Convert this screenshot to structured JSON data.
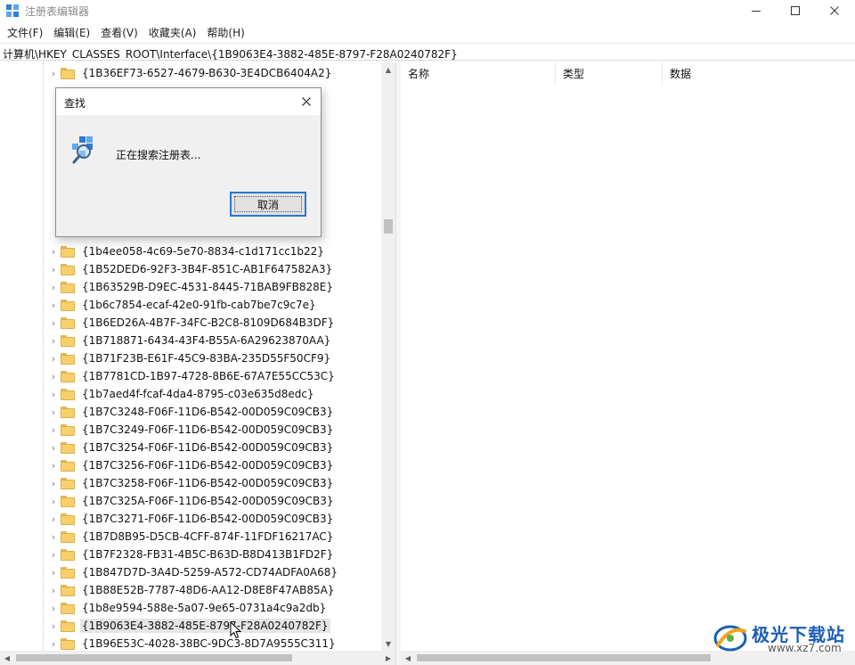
{
  "window": {
    "title": "注册表编辑器",
    "controls": {
      "minimize": "minimize-icon",
      "maximize": "maximize-icon",
      "close": "close-icon"
    }
  },
  "menu": [
    "文件(F)",
    "编辑(E)",
    "查看(V)",
    "收藏夹(A)",
    "帮助(H)"
  ],
  "address": "计算机\\HKEY_CLASSES_ROOT\\Interface\\{1B9063E4-3882-485E-8797-F28A0240782F}",
  "tree": {
    "items": [
      {
        "label": "{1B36EF73-6527-4679-B630-3E4DCB6404A2}"
      },
      {
        "label": "{1b4ee058-4c69-5e70-8834-c1d171cc1b22}"
      },
      {
        "label": "{1B52DED6-92F3-3B4F-851C-AB1F647582A3}"
      },
      {
        "label": "{1B63529B-D9EC-4531-8445-71BAB9FB828E}"
      },
      {
        "label": "{1b6c7854-ecaf-42e0-91fb-cab7be7c9c7e}"
      },
      {
        "label": "{1B6ED26A-4B7F-34FC-B2C8-8109D684B3DF}"
      },
      {
        "label": "{1B718871-6434-43F4-B55A-6A29623870AA}"
      },
      {
        "label": "{1B71F23B-E61F-45C9-83BA-235D55F50CF9}"
      },
      {
        "label": "{1B7781CD-1B97-4728-8B6E-67A7E55CC53C}"
      },
      {
        "label": "{1b7aed4f-fcaf-4da4-8795-c03e635d8edc}"
      },
      {
        "label": "{1B7C3248-F06F-11D6-B542-00D059C09CB3}"
      },
      {
        "label": "{1B7C3249-F06F-11D6-B542-00D059C09CB3}"
      },
      {
        "label": "{1B7C3254-F06F-11D6-B542-00D059C09CB3}"
      },
      {
        "label": "{1B7C3256-F06F-11D6-B542-00D059C09CB3}"
      },
      {
        "label": "{1B7C3258-F06F-11D6-B542-00D059C09CB3}"
      },
      {
        "label": "{1B7C325A-F06F-11D6-B542-00D059C09CB3}"
      },
      {
        "label": "{1B7C3271-F06F-11D6-B542-00D059C09CB3}"
      },
      {
        "label": "{1B7D8B95-D5CB-4CFF-874F-11FDF16217AC}"
      },
      {
        "label": "{1B7F2328-FB31-4B5C-B63D-B8D413B1FD2F}"
      },
      {
        "label": "{1B847D7D-3A4D-5259-A572-CD74ADFA0A68}"
      },
      {
        "label": "{1B88E52B-7787-48D6-AA12-D8E8F47AB85A}"
      },
      {
        "label": "{1b8e9594-588e-5a07-9e65-0731a4c9a2db}"
      },
      {
        "label": "{1B9063E4-3882-485E-8797-F28A0240782F}",
        "selected": true
      },
      {
        "label": "{1B96E53C-4028-38BC-9DC3-8D7A9555C311}"
      }
    ]
  },
  "values_pane": {
    "columns": [
      "名称",
      "类型",
      "数据"
    ]
  },
  "find_dialog": {
    "title": "查找",
    "message": "正在搜索注册表...",
    "cancel_label": "取消",
    "icon": "registry-search-icon"
  },
  "watermark": {
    "text": "极光下载站",
    "url": "www.xz7.com"
  },
  "colors": {
    "folder": "#f7cf6b",
    "selection": "#e5e5e5",
    "dialog_background": "#f0f0f0",
    "focus_border": "#2a78d6",
    "watermark_blue": "#1b5fb4"
  }
}
